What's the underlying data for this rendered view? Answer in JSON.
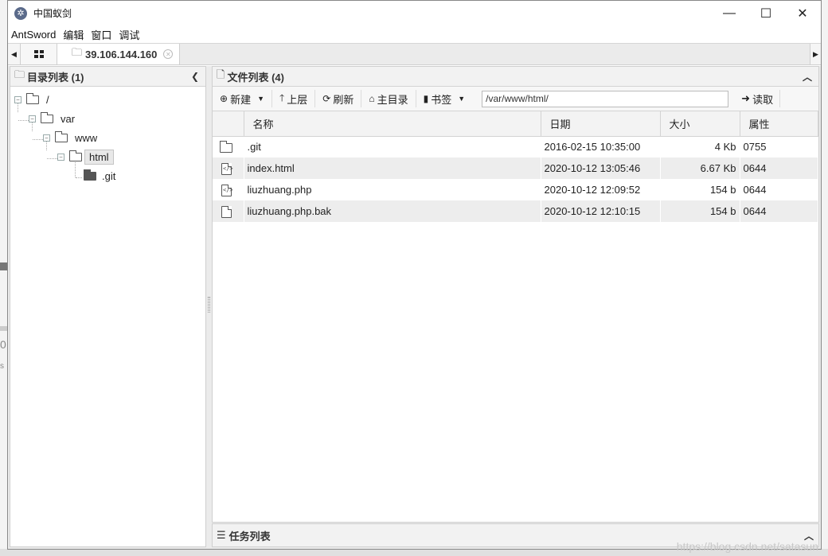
{
  "window": {
    "title": "中国蚁剑"
  },
  "menu": [
    "AntSword",
    "编辑",
    "窗口",
    "调试"
  ],
  "tabs": {
    "active_label": "39.106.144.160"
  },
  "dir_panel": {
    "title": "目录列表 (1)",
    "tree": [
      {
        "label": "/",
        "expanded": true
      },
      {
        "label": "var",
        "expanded": true
      },
      {
        "label": "www",
        "expanded": true
      },
      {
        "label": "html",
        "expanded": true,
        "selected": true
      },
      {
        "label": ".git",
        "expanded": false
      }
    ]
  },
  "file_panel": {
    "title": "文件列表 (4)",
    "toolbar": {
      "new_label": "新建",
      "up_label": "上层",
      "refresh_label": "刷新",
      "home_label": "主目录",
      "bookmark_label": "书签",
      "path_value": "/var/www/html/",
      "read_label": "读取"
    },
    "columns": [
      "名称",
      "日期",
      "大小",
      "属性"
    ],
    "rows": [
      {
        "icon": "folder-icon",
        "name": ".git",
        "date": "2016-02-15 10:35:00",
        "size": "4 Kb",
        "perm": "0755"
      },
      {
        "icon": "code-file-icon",
        "name": "index.html",
        "date": "2020-10-12 13:05:46",
        "size": "6.67 Kb",
        "perm": "0644"
      },
      {
        "icon": "code-file-icon",
        "name": "liuzhuang.php",
        "date": "2020-10-12 12:09:52",
        "size": "154 b",
        "perm": "0644"
      },
      {
        "icon": "file-icon",
        "name": "liuzhuang.php.bak",
        "date": "2020-10-12 12:10:15",
        "size": "154 b",
        "perm": "0644"
      }
    ]
  },
  "task_panel": {
    "title": "任务列表"
  },
  "watermark": "https://blog.csdn.net/satasun"
}
